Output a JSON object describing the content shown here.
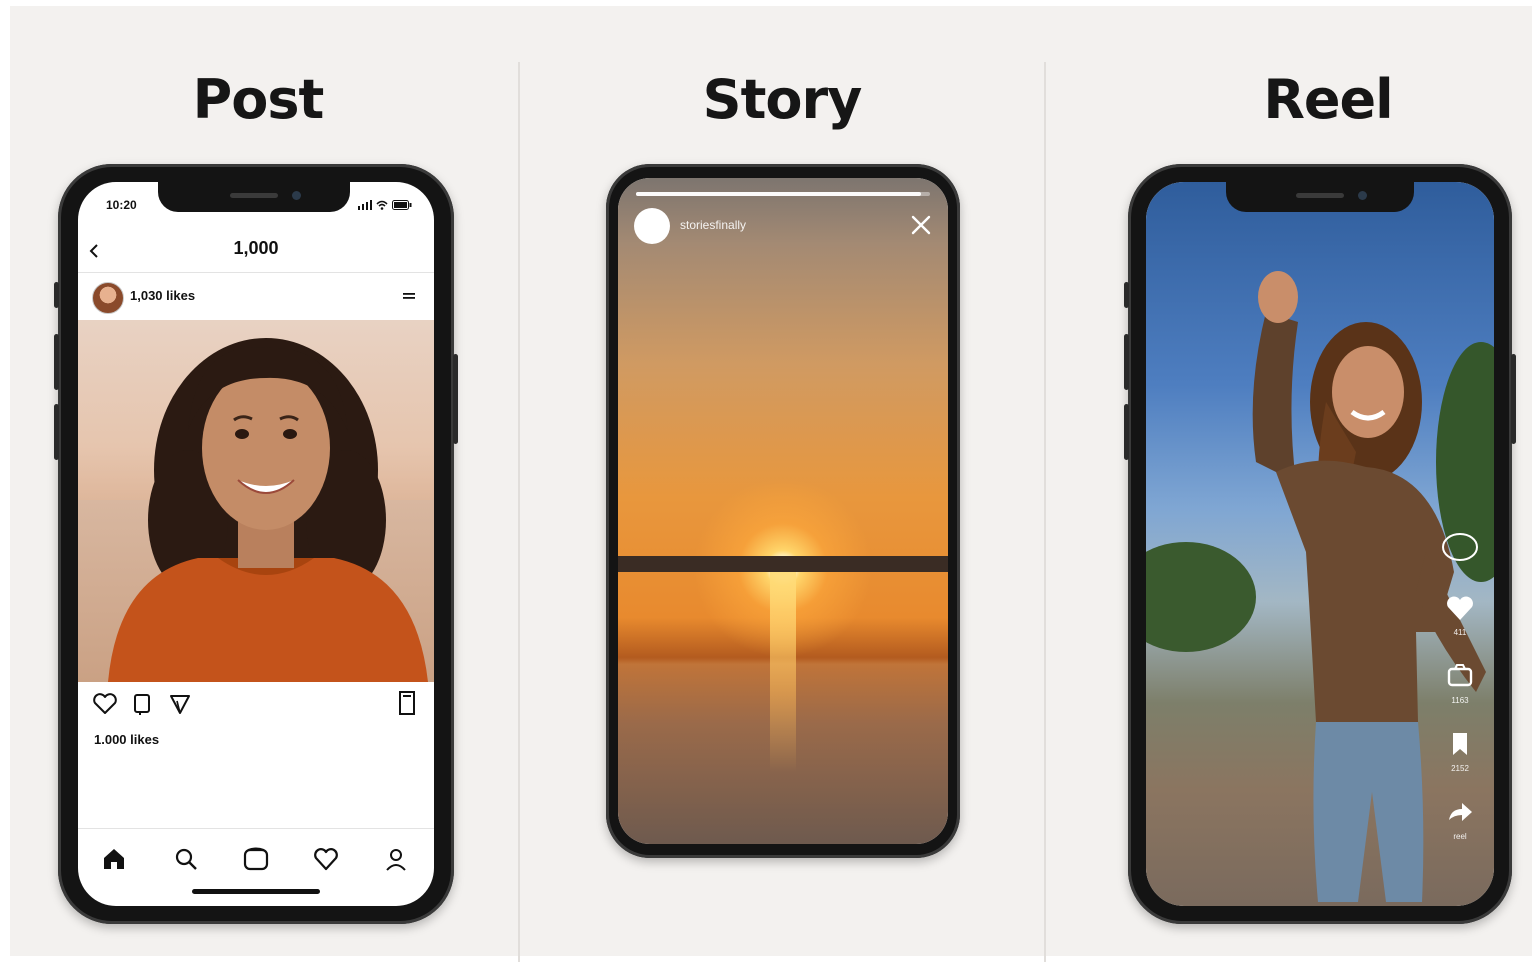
{
  "columns": [
    {
      "title": "Post"
    },
    {
      "title": "Story"
    },
    {
      "title": "Reel"
    }
  ],
  "post": {
    "status_time": "10:20",
    "header_title": "1,000",
    "username": "1,030 likes",
    "likes_text": "1.000 likes"
  },
  "story": {
    "username": "storiesfinally",
    "progress": 0.97
  },
  "reel": {
    "actions": [
      {
        "icon": "heart-icon",
        "label": "411"
      },
      {
        "icon": "camera-icon",
        "label": "1163"
      },
      {
        "icon": "bookmark-icon",
        "label": "2152"
      },
      {
        "icon": "share-icon",
        "label": "reel"
      }
    ]
  },
  "colors": {
    "board": "#f3f1ef",
    "phone_frame": "#141414",
    "title_text": "#161616"
  },
  "icons": {
    "post_tabbar": [
      "home-icon",
      "search-icon",
      "reels-icon",
      "heart-icon",
      "profile-icon"
    ],
    "post_actions": [
      "heart-icon",
      "comment-icon",
      "send-icon",
      "bookmark-icon"
    ]
  }
}
